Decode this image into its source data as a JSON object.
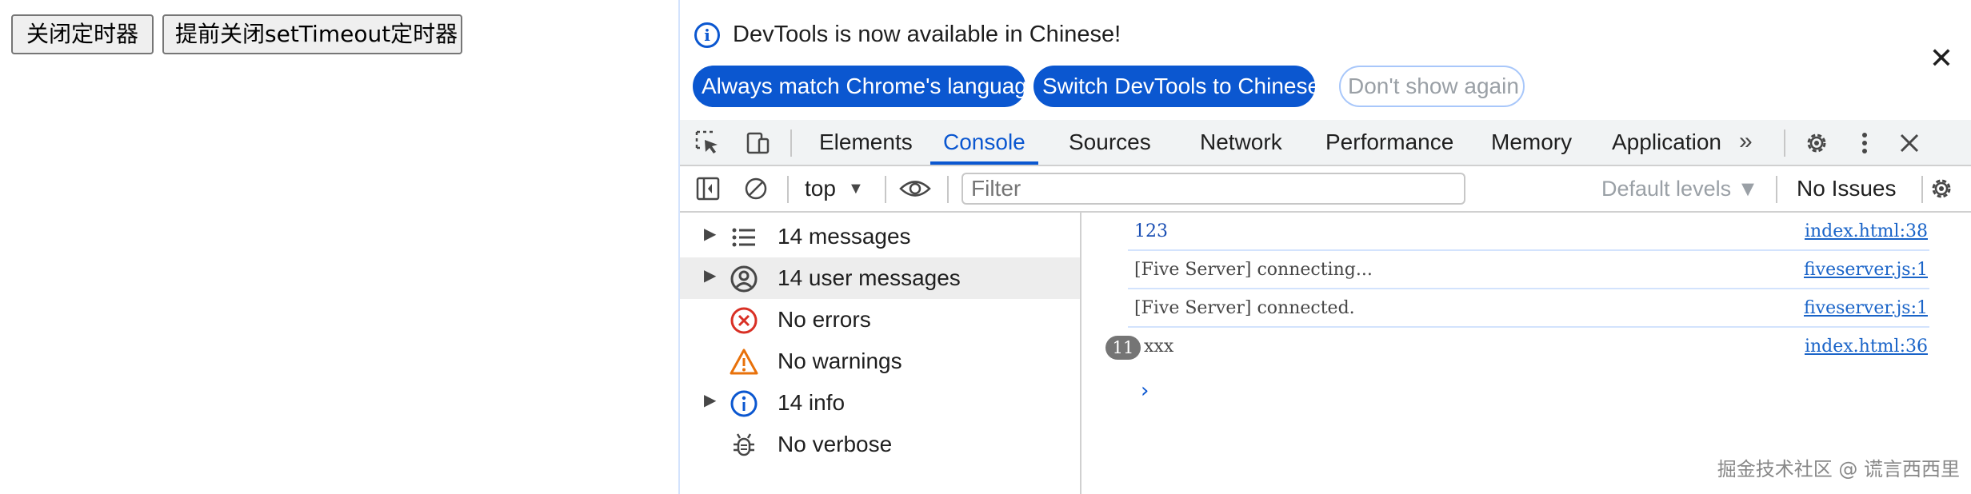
{
  "page": {
    "buttons": [
      {
        "label": "关闭定时器"
      },
      {
        "label": "提前关闭setTimeout定时器"
      }
    ]
  },
  "infobar": {
    "message": "DevTools is now available in Chinese!",
    "actions": [
      {
        "label": "Always match Chrome's language"
      },
      {
        "label": "Switch DevTools to Chinese"
      },
      {
        "label": "Don't show again"
      }
    ],
    "close_glyph": "✕",
    "colors": {
      "accent": "#0b57d0"
    }
  },
  "tabs": {
    "items": [
      {
        "label": "Elements"
      },
      {
        "label": "Console"
      },
      {
        "label": "Sources"
      },
      {
        "label": "Network"
      },
      {
        "label": "Performance"
      },
      {
        "label": "Memory"
      },
      {
        "label": "Application"
      }
    ],
    "active": "Console",
    "more_glyph": "»",
    "icons": [
      "inspect-element-icon",
      "device-toolbar-icon",
      "settings-icon",
      "more-options-icon",
      "close-icon"
    ]
  },
  "toolbar": {
    "context": "top",
    "filter_placeholder": "Filter",
    "levels": "Default levels",
    "issues": "No Issues"
  },
  "sidebar": {
    "items": [
      {
        "label": "14 messages",
        "icon": "list-icon",
        "expandable": true
      },
      {
        "label": "14 user messages",
        "icon": "user-icon",
        "expandable": true,
        "selected": true
      },
      {
        "label": "No errors",
        "icon": "error-icon",
        "expandable": false
      },
      {
        "label": "No warnings",
        "icon": "warning-icon",
        "expandable": false
      },
      {
        "label": "14 info",
        "icon": "info-icon",
        "expandable": true
      },
      {
        "label": "No verbose",
        "icon": "bug-icon",
        "expandable": false
      }
    ]
  },
  "console": {
    "messages": [
      {
        "text": "123",
        "source": "index.html:38"
      },
      {
        "text": "[Five Server] connecting...",
        "source": "fiveserver.js:1"
      },
      {
        "text": "[Five Server] connected.",
        "source": "fiveserver.js:1"
      },
      {
        "text": "xxx",
        "source": "index.html:36",
        "repeat": "11"
      }
    ],
    "prompt_glyph": "›"
  },
  "watermark": "掘金技术社区 @ 谎言西西里"
}
